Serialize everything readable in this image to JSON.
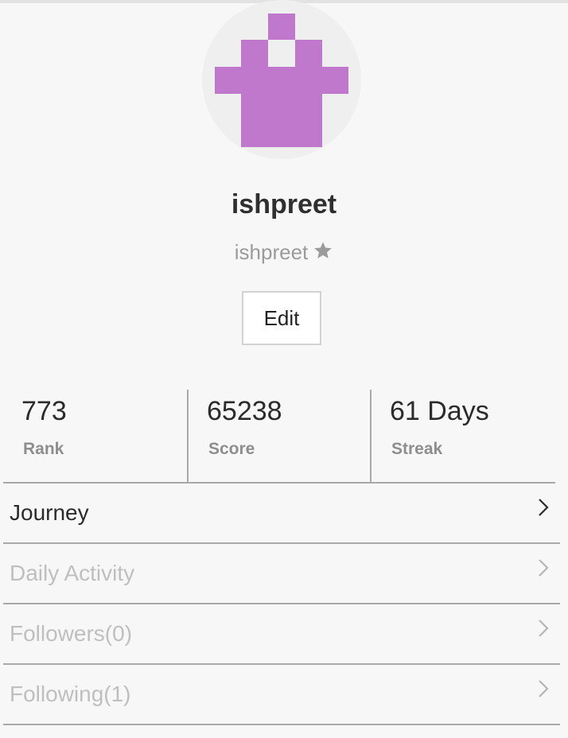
{
  "profile": {
    "display_name": "ishpreet",
    "username": "ishpreet",
    "edit_label": "Edit",
    "avatar_color": "#bf78cc",
    "avatar_bg": "#efefef"
  },
  "stats": [
    {
      "value": "773",
      "label": "Rank"
    },
    {
      "value": "65238",
      "label": "Score"
    },
    {
      "value": "61 Days",
      "label": "Streak"
    }
  ],
  "menu": [
    {
      "label": "Journey",
      "enabled": true
    },
    {
      "label": "Daily Activity",
      "enabled": false
    },
    {
      "label": "Followers(0)",
      "enabled": false
    },
    {
      "label": "Following(1)",
      "enabled": false
    }
  ],
  "colors": {
    "divider": "#a9a9a9",
    "disabled_text": "#bfbfbf",
    "muted_text": "#9b9b9b"
  },
  "icons": {
    "star": "star-icon",
    "chevron": "chevron-right-icon"
  }
}
